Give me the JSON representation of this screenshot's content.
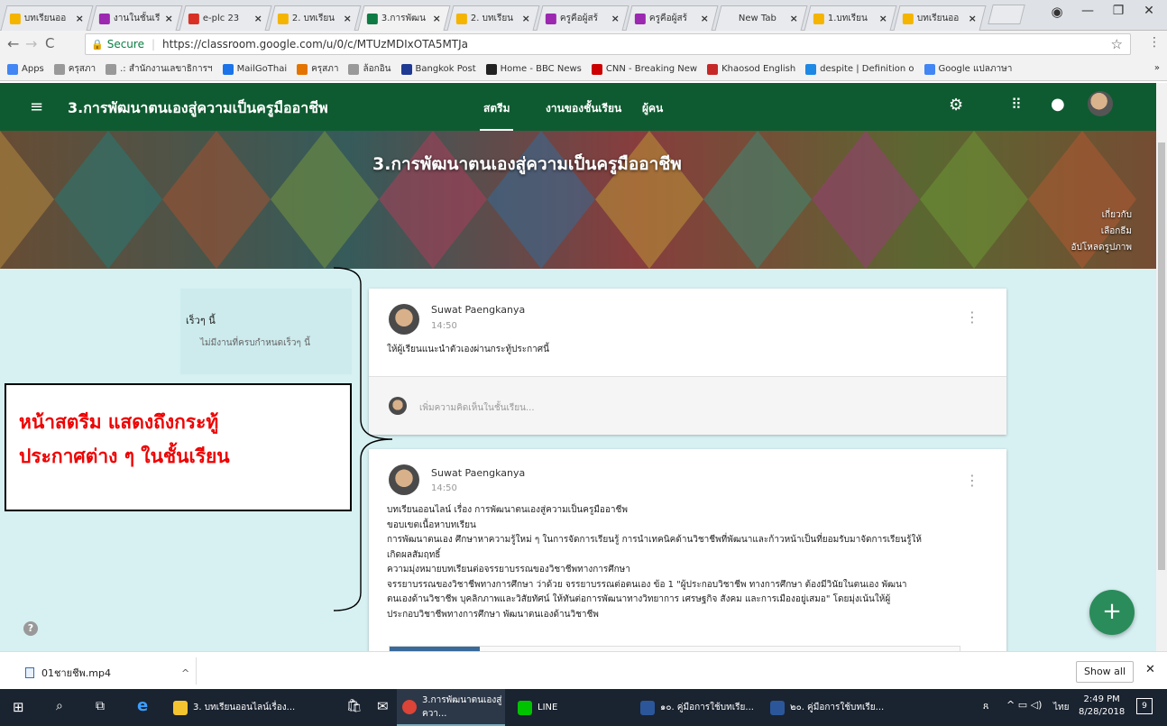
{
  "browser": {
    "tabs": [
      {
        "label": "บทเรียนออ",
        "color": "#f4b400"
      },
      {
        "label": "งานในชั้นเรี",
        "color": "#9c27b0"
      },
      {
        "label": "e-plc 23",
        "color": "#d93025"
      },
      {
        "label": "2. บทเรียน",
        "color": "#f4b400"
      },
      {
        "label": "3.การพัฒน",
        "color": "#0f7b44"
      },
      {
        "label": "2. บทเรียน",
        "color": "#f4b400"
      },
      {
        "label": "ครูคือผู้สร้",
        "color": "#9c27b0"
      },
      {
        "label": "ครูคือผู้สร้",
        "color": "#9c27b0"
      },
      {
        "label": "New Tab",
        "color": ""
      },
      {
        "label": "1.บทเรียน",
        "color": "#f4b400"
      },
      {
        "label": "บทเรียนออ",
        "color": "#f4b400"
      }
    ],
    "active_tab_index": 4,
    "url_secure": "Secure",
    "url": "https://classroom.google.com/u/0/c/MTUzMDIxOTA5MTJa",
    "bookmarks": [
      {
        "label": "Apps",
        "color": "#4285f4"
      },
      {
        "label": "ครุสภา",
        "color": "#999999"
      },
      {
        "label": ".: สำนักงานเลขาธิการฯ",
        "color": "#999999"
      },
      {
        "label": "MailGoThai",
        "color": "#1a73e8"
      },
      {
        "label": "ครุสภา",
        "color": "#e37400"
      },
      {
        "label": "ล้อกอิน",
        "color": "#999999"
      },
      {
        "label": "Bangkok Post",
        "color": "#1f3a93"
      },
      {
        "label": "Home - BBC News",
        "color": "#222222"
      },
      {
        "label": "CNN - Breaking New",
        "color": "#cc0000"
      },
      {
        "label": "Khaosod English",
        "color": "#c62828"
      },
      {
        "label": "despite | Definition o",
        "color": "#1e88e5"
      },
      {
        "label": "Google แปลภาษา",
        "color": "#4285f4"
      }
    ],
    "bookmarks_more": "»"
  },
  "classroom": {
    "menu_icon": "≡",
    "course_title": "3.การพัฒนาตนเองสู่ความเป็นครูมืออาชีพ",
    "nav_tabs": [
      "สตรีม",
      "งานของชั้นเรียน",
      "ผู้คน"
    ],
    "active_nav": 0,
    "banner_title": "3.การพัฒนาตนเองสู่ความเป็นครูมืออาชีพ",
    "banner_links": [
      "เกี่ยวกับ",
      "เลือกธีม",
      "อัปโหลดรูปภาพ"
    ],
    "upcoming": {
      "heading": "เร็วๆ นี้",
      "empty": "ไม่มีงานที่ครบกำหนดเร็วๆ นี้"
    },
    "posts": [
      {
        "author": "Suwat Paengkanya",
        "time": "14:50",
        "body": [
          "ให้ผู้เรียนแนะนำตัวเองผ่านกระทู้ประกาศนี้"
        ],
        "comment_placeholder": "เพิ่มความคิดเห็นในชั้นเรียน..."
      },
      {
        "author": "Suwat Paengkanya",
        "time": "14:50",
        "body": [
          "บทเรียนออนไลน์ เรื่อง การพัฒนาตนเองสู่ความเป็นครูมืออาชีพ",
          "ขอบเขตเนื้อหาบทเรียน",
          "การพัฒนาตนเอง ศึกษาหาความรู้ใหม่ ๆ ในการจัดการเรียนรู้ การนำเทคนิคด้านวิชาชีพที่พัฒนาและก้าวหน้าเป็นที่ยอมรับมาจัดการเรียนรู้ให้",
          "เกิดผลสัมฤทธิ์",
          "ความมุ่งหมายบทเรียนต่อจรรยาบรรณของวิชาชีพทางการศึกษา",
          "จรรยาบรรณของวิชาชีพทางการศึกษา ว่าด้วย จรรยาบรรณต่อตนเอง ข้อ 1 \"ผู้ประกอบวิชาชีพ ทางการศึกษา ต้องมีวินัยในตนเอง พัฒนา",
          "ตนเองด้านวิชาชีพ บุคลิกภาพและวิสัยทัศน์ ให้ทันต่อการพัฒนาทางวิทยาการ เศรษฐกิจ สังคม และการเมืองอยู่เสมอ\" โดยมุ่งเน้นให้ผู้",
          "ประกอบวิชาชีพทางการศึกษา พัฒนาตนเองด้านวิชาชีพ"
        ]
      }
    ],
    "callout_lines": [
      "หน้าสตรีม แสดงถึงกระทู้",
      "ประกาศต่าง ๆ ในชั้นเรียน"
    ],
    "fab": "+",
    "help": "?"
  },
  "download": {
    "file": "01ชายชีพ.mp4",
    "show_all": "Show all",
    "close": "✕"
  },
  "taskbar": {
    "items": [
      {
        "label": "3. บทเรียนออนไลน์เรื่อง...",
        "color": "#f4c430"
      },
      {
        "label": "3.การพัฒนาตนเองสู่ควา...",
        "color": "#db4437"
      },
      {
        "label": "LINE",
        "color": "#00c300"
      },
      {
        "label": "๑๐. คู่มือการใช้บทเรีย...",
        "color": "#2b579a"
      },
      {
        "label": "๒๐. คู่มือการใช้บทเรีย...",
        "color": "#2b579a"
      }
    ],
    "lang": "ไทย",
    "time": "2:49 PM",
    "date": "8/28/2018",
    "notif": "9"
  },
  "colors": {
    "header": "#0f5b31",
    "stream_bg": "#d7f0f2",
    "fab": "#2a8c5a",
    "callout_text": "#e00000"
  }
}
